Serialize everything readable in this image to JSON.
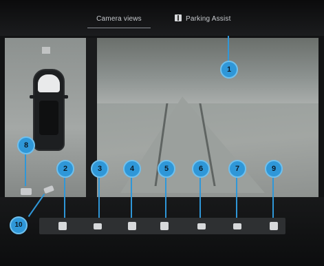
{
  "header": {
    "tab_camera_views": "Camera views",
    "tab_parking_assist": "Parking Assist"
  },
  "callouts": {
    "c1": "1",
    "c2": "2",
    "c3": "3",
    "c4": "4",
    "c5": "5",
    "c6": "6",
    "c7": "7",
    "c8": "8",
    "c9": "9",
    "c10": "10"
  },
  "icons": {
    "parking_assist": "parking-assist-icon",
    "toolbar": [
      "trash-icon",
      "person-icon",
      "rear-view-icon",
      "side-view-icon",
      "car-top-icon",
      "trailer-icon",
      "wheel-icon"
    ],
    "left_controls": [
      "car-icon",
      "wrench-icon"
    ]
  },
  "colors": {
    "callout": "#2f97d8",
    "background": "#121314"
  }
}
